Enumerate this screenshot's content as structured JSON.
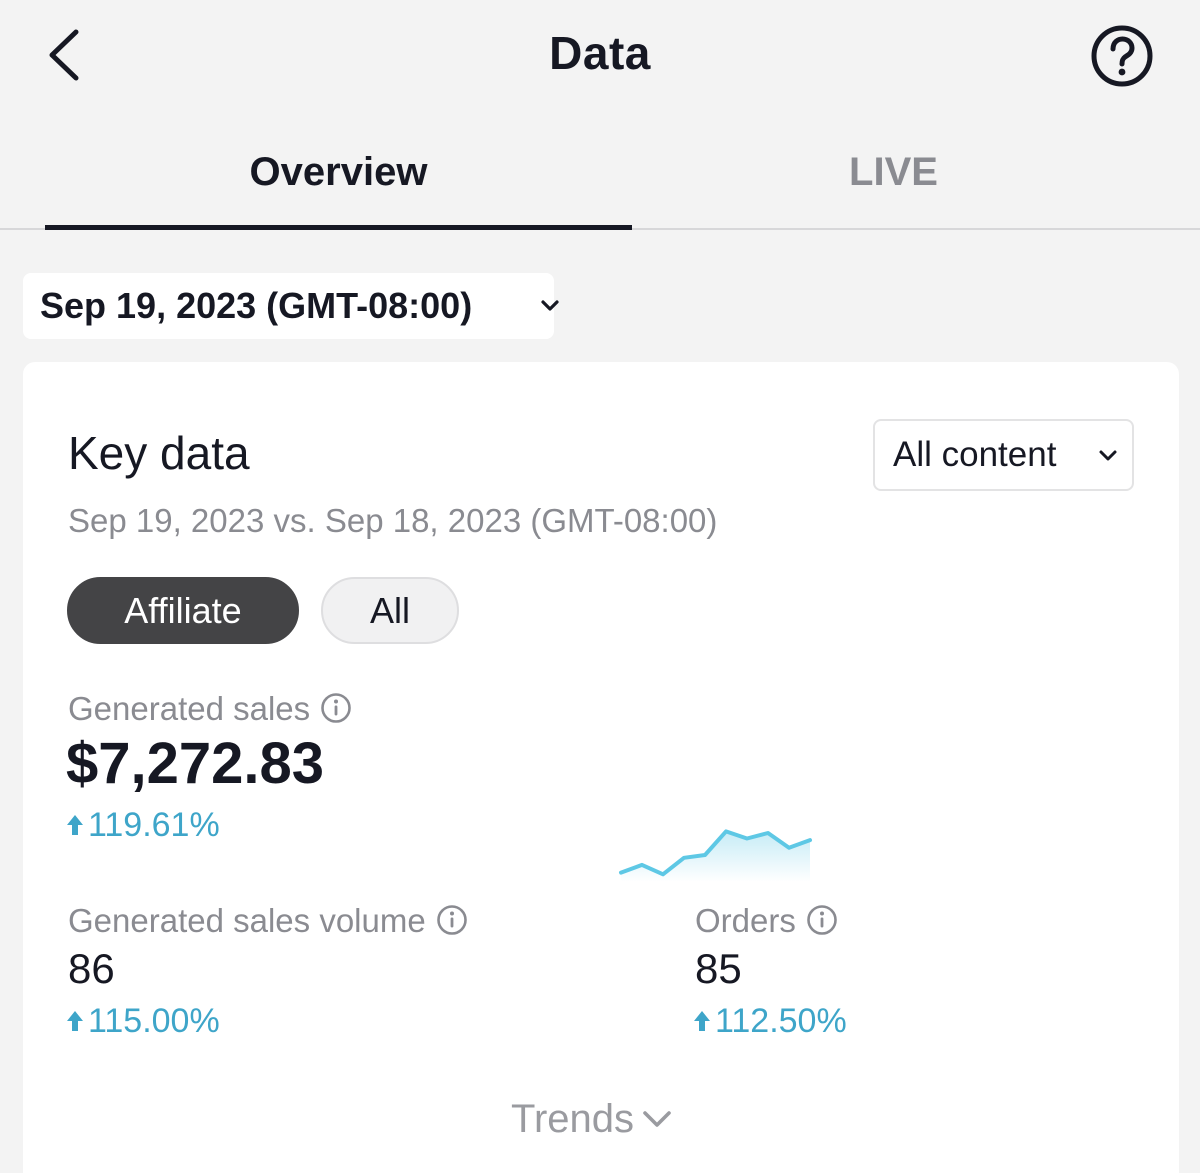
{
  "header": {
    "title": "Data",
    "back_icon": "chevron-left-icon",
    "help_icon": "question-circle-icon"
  },
  "tabs": [
    {
      "label": "Overview",
      "active": true
    },
    {
      "label": "LIVE",
      "active": false
    }
  ],
  "date_filter": {
    "value": "Sep 19, 2023 (GMT-08:00)",
    "icon": "chevron-down-icon"
  },
  "key_data": {
    "title": "Key data",
    "subtitle": "Sep 19, 2023 vs. Sep 18, 2023 (GMT-08:00)",
    "content_filter": "All content",
    "segments": [
      {
        "label": "Affiliate",
        "selected": true
      },
      {
        "label": "All",
        "selected": false
      }
    ],
    "generated_sales": {
      "label": "Generated sales",
      "value": "$7,272.83",
      "change": "119.61%",
      "trend_points": [
        0.08,
        0.22,
        0.05,
        0.35,
        0.4,
        0.83,
        0.7,
        0.8,
        0.53,
        0.67
      ]
    },
    "generated_sales_volume": {
      "label": "Generated sales volume",
      "value": "86",
      "change": "115.00%"
    },
    "orders": {
      "label": "Orders",
      "value": "85",
      "change": "112.50%"
    },
    "trends_label": "Trends"
  },
  "colors": {
    "text_primary": "#161823",
    "text_secondary": "#8a8b91",
    "positive_change": "#3ea5c9",
    "sparkline": "#5ec8e5",
    "pill_selected_bg": "#444446",
    "page_bg": "#f3f3f3"
  }
}
